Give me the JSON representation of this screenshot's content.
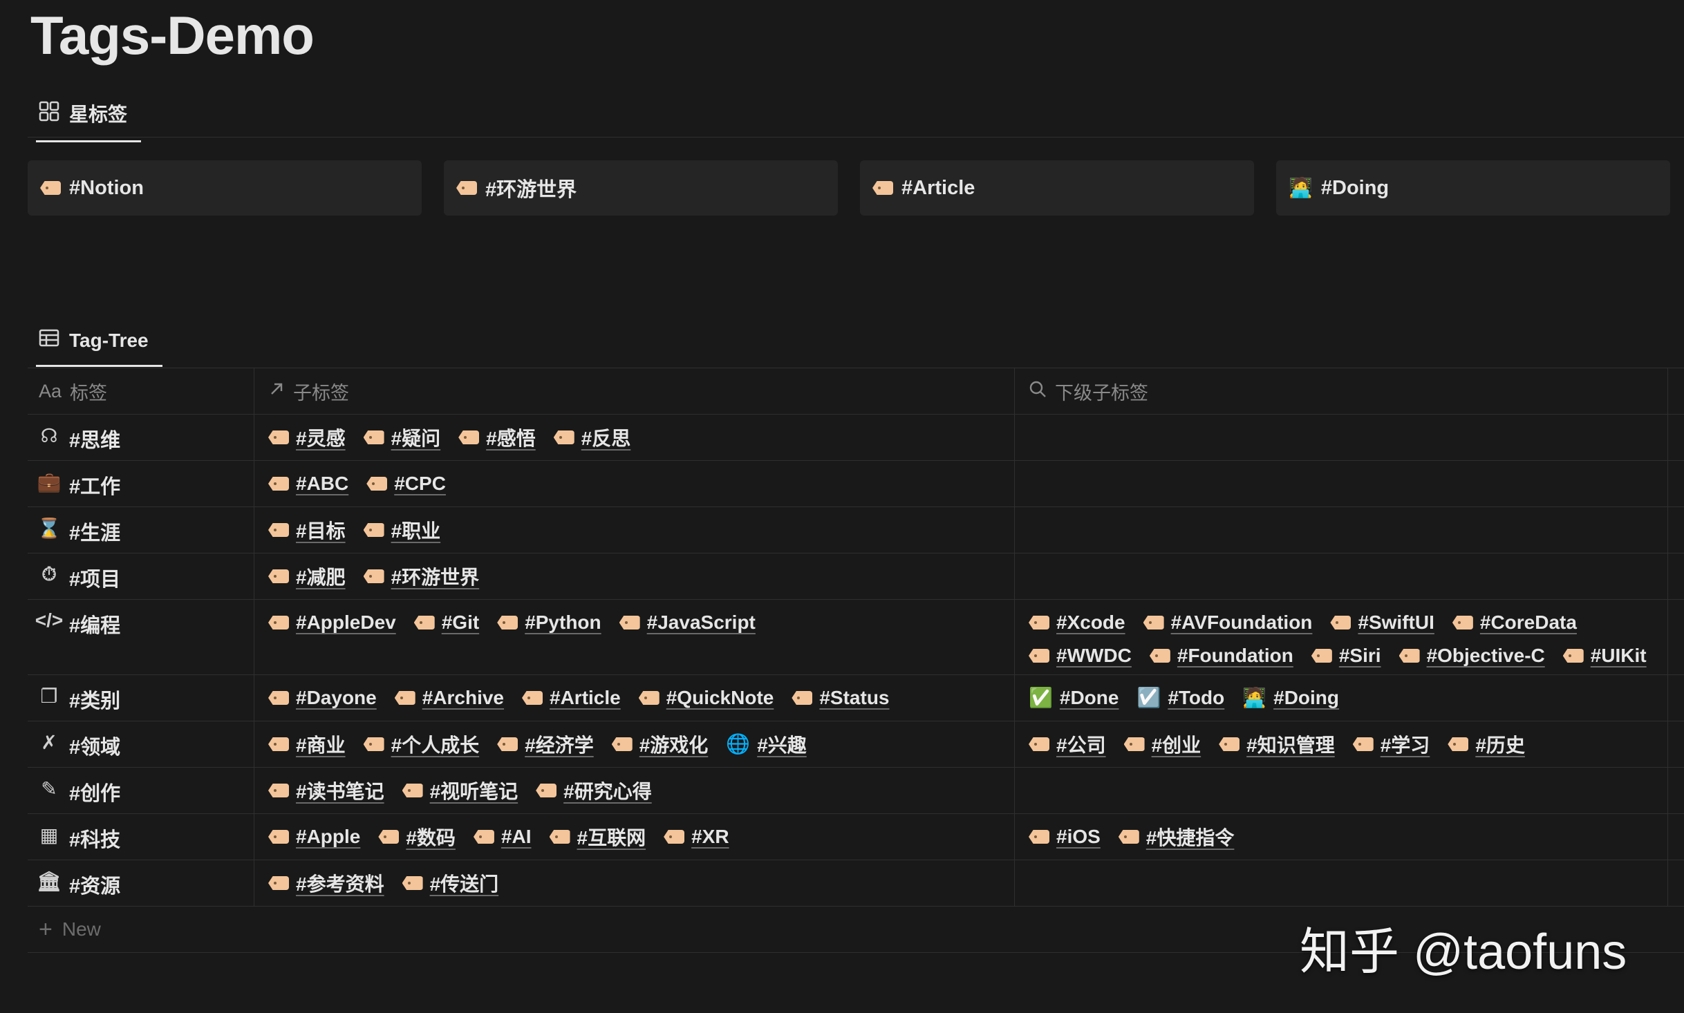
{
  "page": {
    "title": "Tags-Demo"
  },
  "views": [
    {
      "label": "星标签",
      "icon": "gallery-icon"
    },
    {
      "label": "Tag-Tree",
      "icon": "table-icon"
    }
  ],
  "gallery": [
    {
      "icon": "tag-icon",
      "label": "#Notion"
    },
    {
      "icon": "tag-icon",
      "label": "#环游世界"
    },
    {
      "icon": "tag-icon",
      "label": "#Article"
    },
    {
      "icon": "technologist-emoji-icon",
      "emoji": "🧑‍💻",
      "label": "#Doing"
    }
  ],
  "table": {
    "headers": [
      {
        "prefix": "Aa",
        "label": "标签",
        "icon": "title-property-icon"
      },
      {
        "label": "子标签",
        "icon": "relation-arrow-icon"
      },
      {
        "label": "下级子标签",
        "icon": "search-icon"
      }
    ],
    "rows": [
      {
        "label": "#思维",
        "icon": "head-profile-icon",
        "glyph": "☊",
        "children": [
          "#灵感",
          "#疑问",
          "#感悟",
          "#反思"
        ],
        "sub": []
      },
      {
        "label": "#工作",
        "icon": "briefcase-icon",
        "glyph": "💼",
        "children": [
          "#ABC",
          "#CPC"
        ],
        "sub": []
      },
      {
        "label": "#生涯",
        "icon": "hourglass-icon",
        "glyph": "⌛",
        "children": [
          "#目标",
          "#职业"
        ],
        "sub": []
      },
      {
        "label": "#项目",
        "icon": "stopwatch-icon",
        "glyph": "⏱",
        "children": [
          "#减肥",
          "#环游世界"
        ],
        "sub": []
      },
      {
        "label": "#编程",
        "icon": "code-icon",
        "glyph": "</>",
        "children": [
          "#AppleDev",
          "#Git",
          "#Python",
          "#JavaScript"
        ],
        "sub": [
          "#Xcode",
          "#AVFoundation",
          "#SwiftUI",
          "#CoreData",
          "#WWDC",
          "#Foundation",
          "#Siri",
          "#Objective-C",
          "#UIKit"
        ]
      },
      {
        "label": "#类别",
        "icon": "copy-icon",
        "glyph": "❐",
        "children": [
          "#Dayone",
          "#Archive",
          "#Article",
          "#QuickNote",
          "#Status"
        ],
        "sub": [
          {
            "label": "#Done",
            "emoji": "✅",
            "icon": "check-box-green-icon"
          },
          {
            "label": "#Todo",
            "emoji": "☑️",
            "icon": "check-box-gray-icon"
          },
          {
            "label": "#Doing",
            "emoji": "🧑‍💻",
            "icon": "technologist-emoji-icon"
          }
        ]
      },
      {
        "label": "#领域",
        "icon": "crossed-tools-icon",
        "glyph": "✗",
        "children": [
          "#商业",
          "#个人成长",
          "#经济学",
          "#游戏化",
          {
            "label": "#兴趣",
            "icon": "globe-icon",
            "glyph": "🌐"
          }
        ],
        "sub": [
          "#公司",
          "#创业",
          "#知识管理",
          "#学习",
          "#历史"
        ]
      },
      {
        "label": "#创作",
        "icon": "edit-icon",
        "glyph": "✎",
        "children": [
          "#读书笔记",
          "#视听笔记",
          "#研究心得"
        ],
        "sub": []
      },
      {
        "label": "#科技",
        "icon": "chip-icon",
        "glyph": "▦",
        "children": [
          "#Apple",
          "#数码",
          "#AI",
          "#互联网",
          "#XR"
        ],
        "sub": [
          "#iOS",
          "#快捷指令"
        ]
      },
      {
        "label": "#资源",
        "icon": "bank-icon",
        "glyph": "🏛",
        "children": [
          "#参考资料",
          "#传送门"
        ],
        "sub": []
      }
    ],
    "new_label": "New"
  },
  "watermark": "知乎 @taofuns"
}
